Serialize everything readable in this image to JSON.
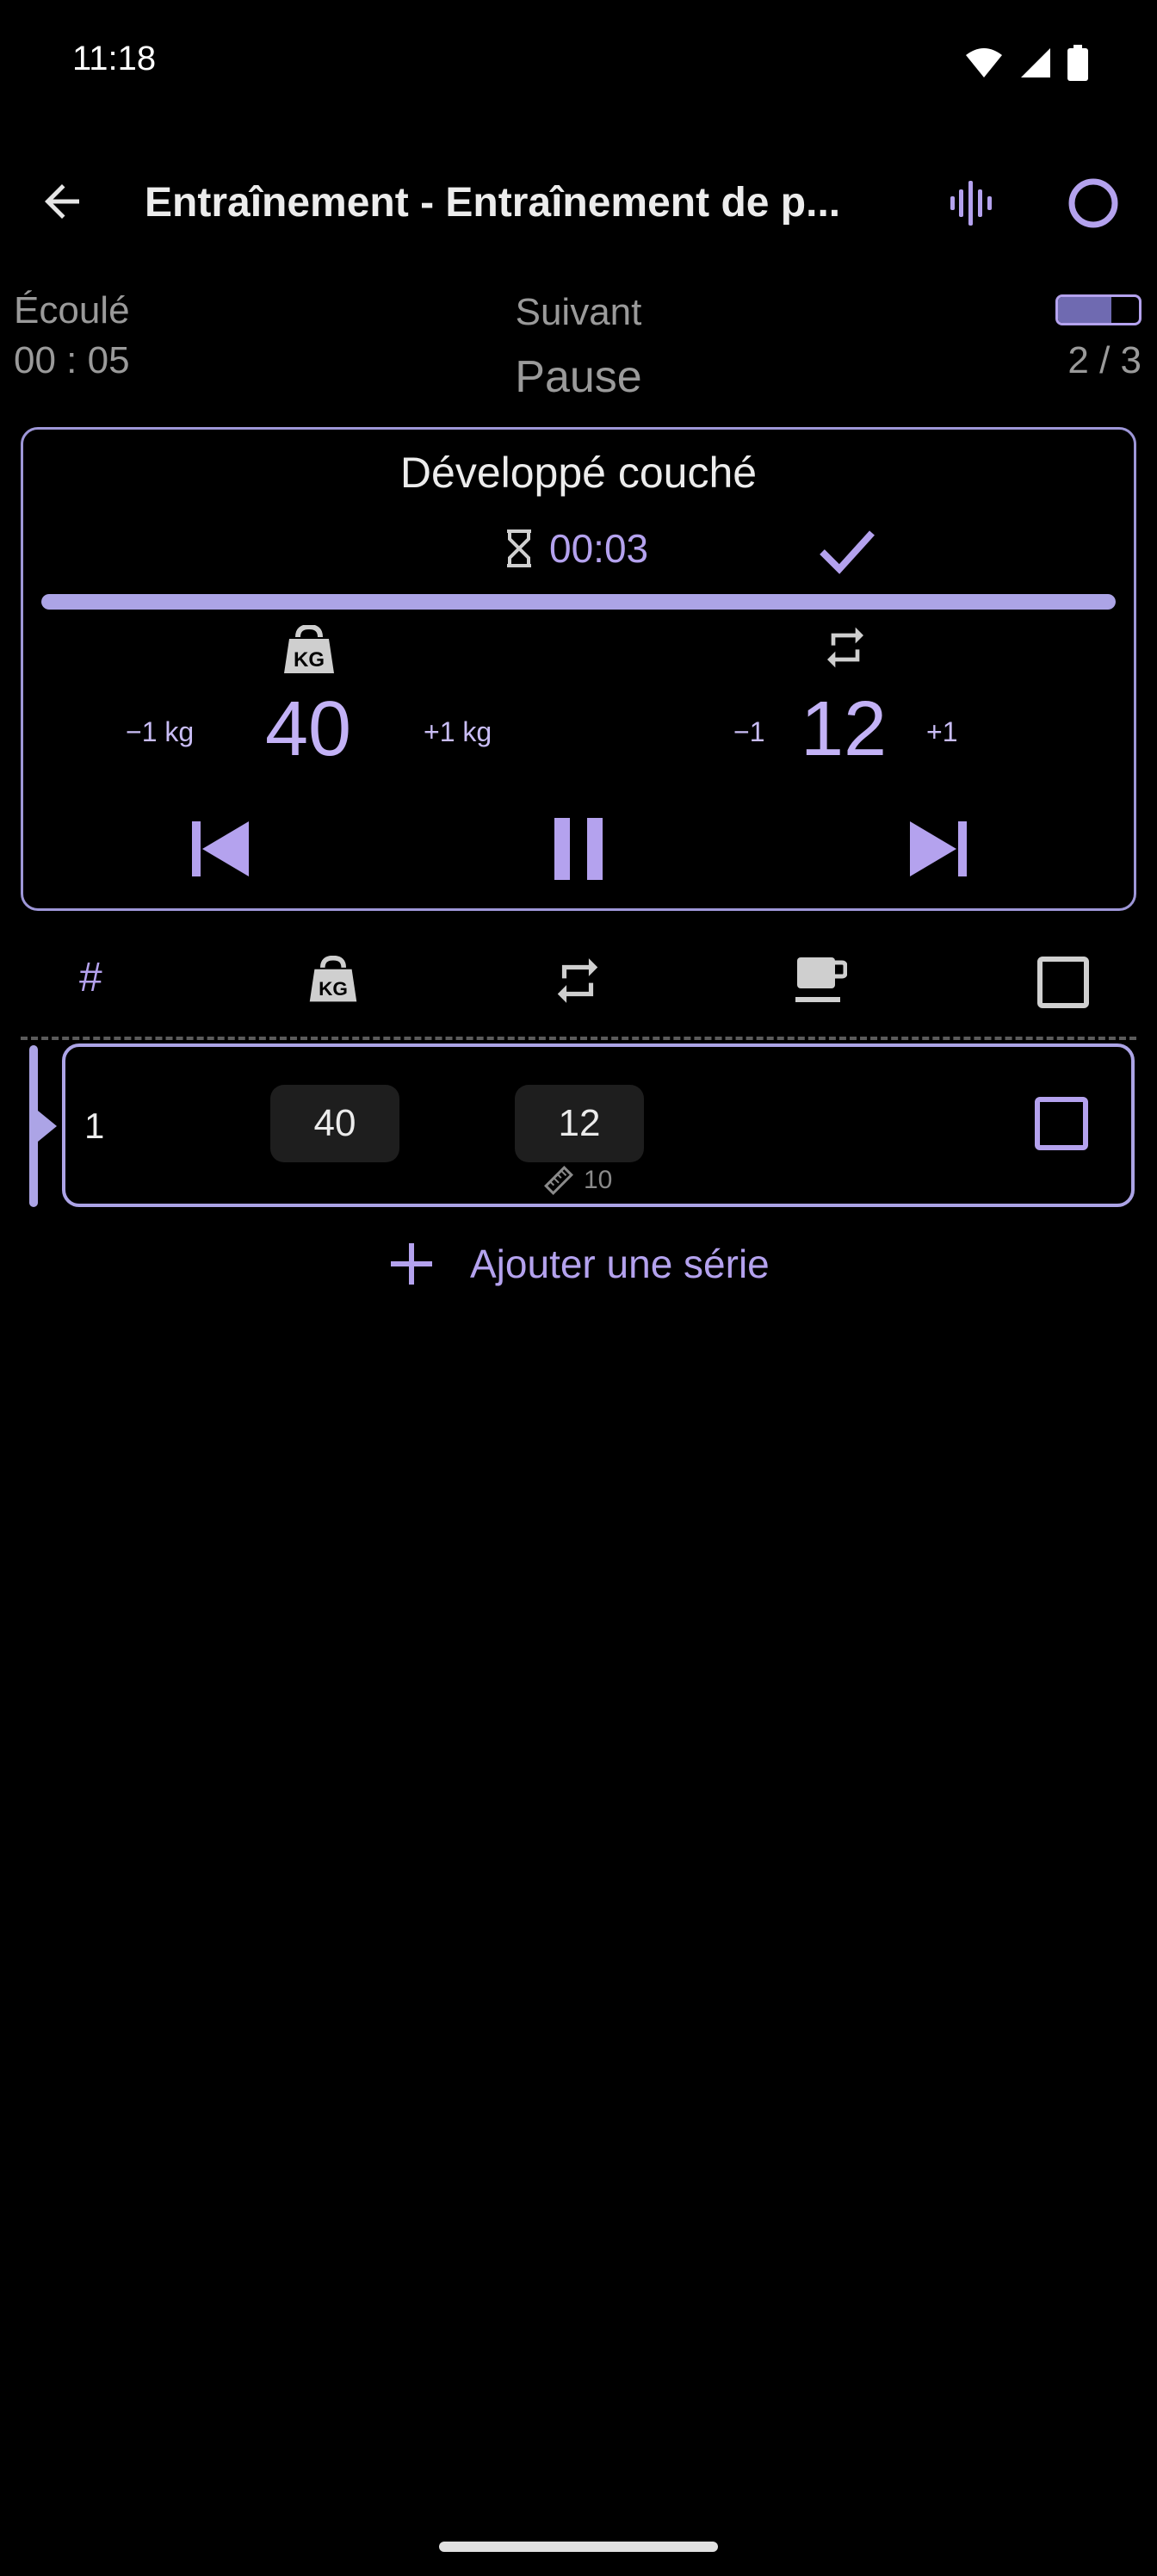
{
  "status": {
    "time": "11:18"
  },
  "appbar": {
    "title": "Entraînement - Entraînement de p..."
  },
  "header": {
    "elapsed_label": "Écoulé",
    "elapsed_value": "00 : 05",
    "next_label": "Suivant",
    "next_value": "Pause",
    "progress_count": "2 / 3",
    "progress_fraction": 0.66
  },
  "exercise": {
    "name": "Développé couché",
    "timer": "00:03",
    "rest_progress": 1.0,
    "weight": {
      "minus": "−1 kg",
      "value": "40",
      "plus": "+1 kg"
    },
    "reps": {
      "minus": "−1",
      "value": "12",
      "plus": "+1"
    }
  },
  "table": {
    "hash": "#",
    "rows": [
      {
        "num": "1",
        "weight": "40",
        "reps": "12",
        "target": "10"
      }
    ]
  },
  "add_set_label": "Ajouter une série",
  "colors": {
    "accent": "#b4a2ee",
    "background": "#000000"
  }
}
